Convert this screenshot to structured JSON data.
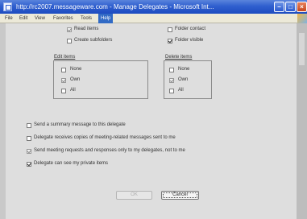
{
  "window": {
    "title": "http://rc2007.messageware.com - Manage Delegates - Microsoft Int..."
  },
  "menubar": {
    "items": [
      "File",
      "Edit",
      "View",
      "Favorites",
      "Tools",
      "Help"
    ]
  },
  "permissions": {
    "read_items_label": "Read items",
    "folder_contact_label": "Folder contact",
    "create_subfolders_label": "Create subfolders",
    "folder_visible_label": "Folder visible",
    "edit_items": {
      "title": "Edit items",
      "options": [
        "None",
        "Own",
        "All"
      ],
      "selected": "Own"
    },
    "delete_items": {
      "title": "Delete items",
      "options": [
        "None",
        "Own",
        "All"
      ],
      "selected": "Own"
    }
  },
  "options": {
    "summary_message": "Send a summary message to this delegate",
    "receives_copies": "Delegate receives copies of meeting-related messages sent to me",
    "send_only_to_delegates": "Send meeting requests and responses only to my delegates, not to me",
    "see_private_items": "Delegate can see my private items",
    "see_private_items_checked": true
  },
  "buttons": {
    "ok_label": "OK",
    "cancel_label": "Cancel"
  },
  "colors": {
    "titlebar": "#2f5fcf",
    "menubar": "#ece9d8",
    "content": "#dedede"
  }
}
